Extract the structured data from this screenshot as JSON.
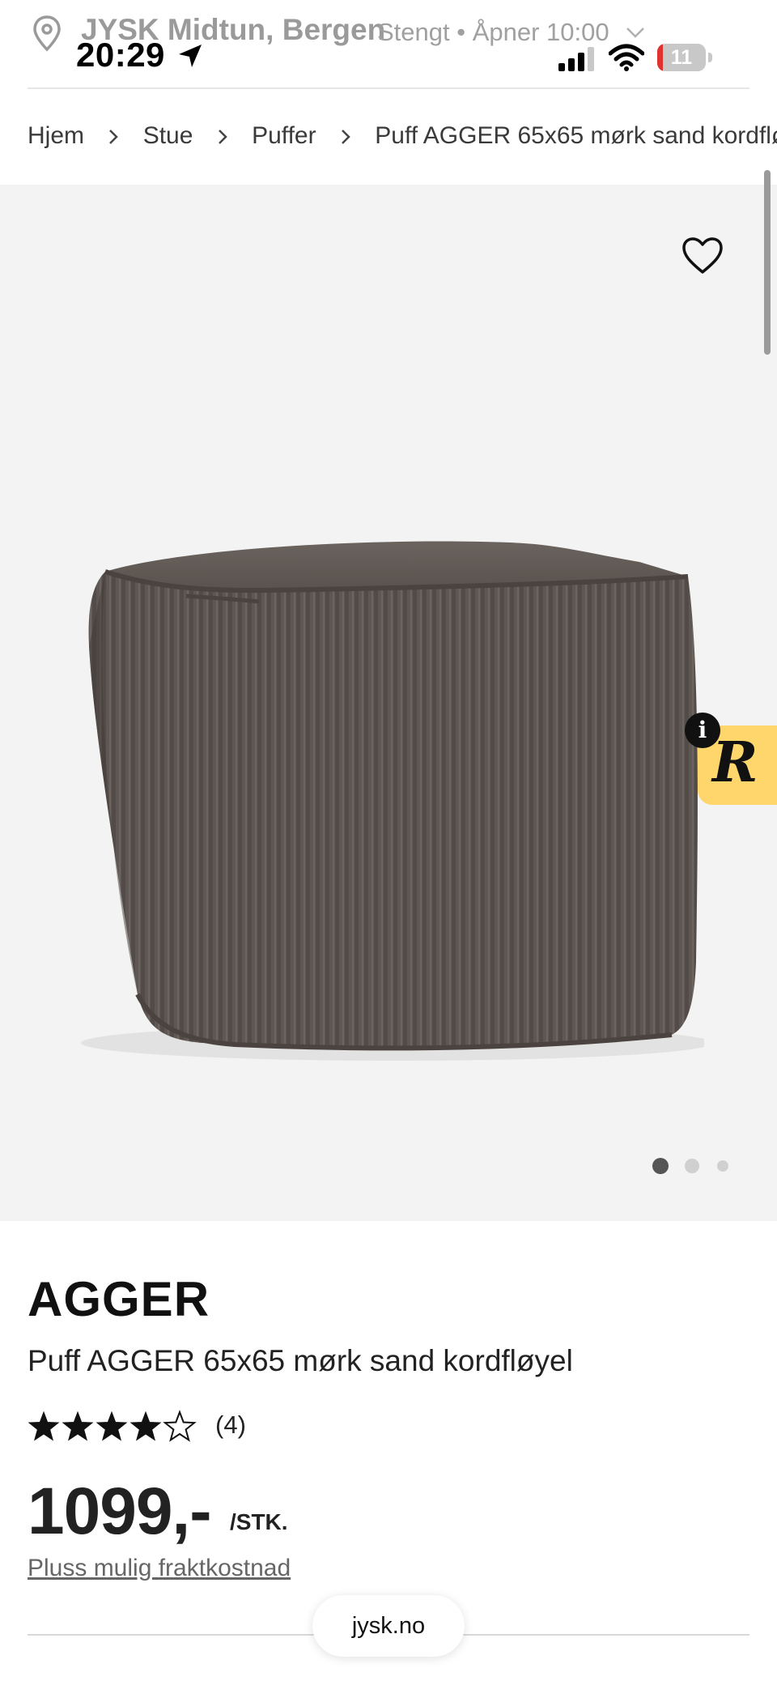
{
  "status_bar": {
    "time": "20:29",
    "battery": "11",
    "battery_level": 0.11,
    "battery_color": "#e0332f"
  },
  "store": {
    "name": "JYSK Midtun, Bergen",
    "hours": "Stengt • Åpner 10:00"
  },
  "breadcrumb": {
    "items": [
      "Hjem",
      "Stue",
      "Puffer",
      "Puff AGGER 65x65 mørk sand kordfløyel"
    ]
  },
  "gallery": {
    "image_count": 3,
    "active_index": 0,
    "image_description": "Square corduroy pouf, dark sand",
    "background_color": "#f3f3f3"
  },
  "reviews_widget": {
    "letter": "R",
    "info": "i",
    "color": "#ffd66b"
  },
  "product": {
    "brand": "AGGER",
    "name": "Puff AGGER 65x65 mørk sand kordfløyel",
    "rating": 4,
    "rating_max": 5,
    "rating_count": "(4)",
    "price": "1099,-",
    "price_unit": "/STK.",
    "shipping_link": "Pluss mulig fraktkostnad"
  },
  "browser": {
    "url": "jysk.no"
  }
}
